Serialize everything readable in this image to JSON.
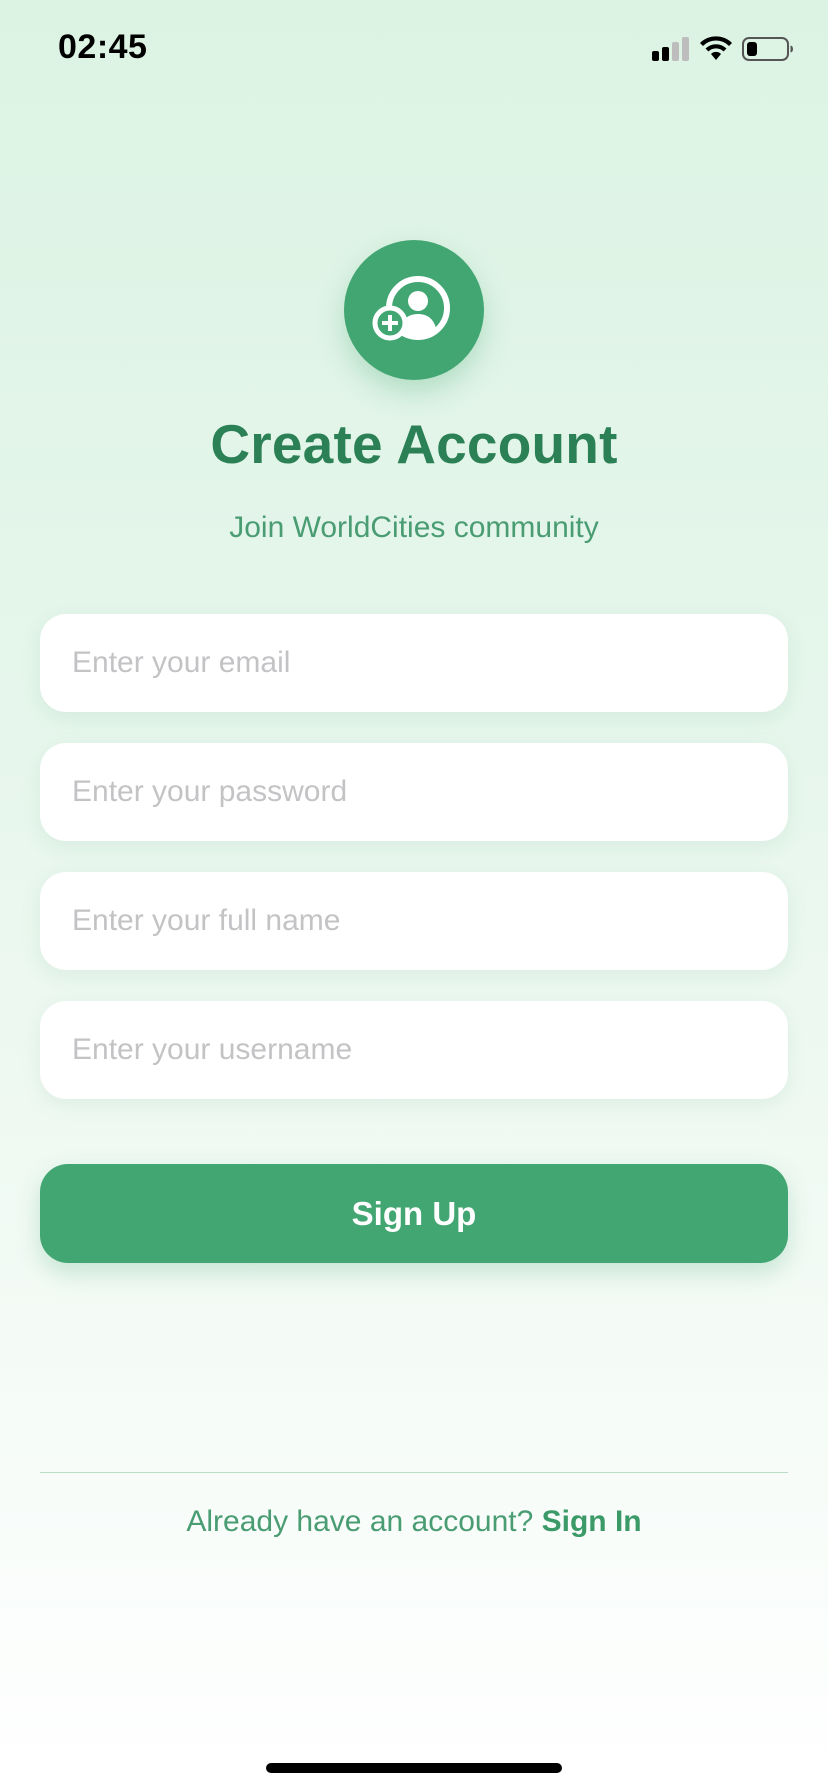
{
  "status_bar": {
    "time": "02:45",
    "icons": [
      "cellular-signal-icon",
      "wifi-icon",
      "battery-icon"
    ]
  },
  "header": {
    "logo_icon": "add-user-icon",
    "title": "Create Account",
    "subtitle": "Join WorldCities community"
  },
  "form": {
    "email_placeholder": "Enter your email",
    "email_value": "",
    "password_placeholder": "Enter your password",
    "password_value": "",
    "fullname_placeholder": "Enter your full name",
    "fullname_value": "",
    "username_placeholder": "Enter your username",
    "username_value": "",
    "submit_label": "Sign Up"
  },
  "footer": {
    "prompt": "Already have an account?",
    "signin_label": "Sign In"
  },
  "colors": {
    "accent": "#42a672",
    "title": "#2c8055",
    "subtitle": "#4a9c73",
    "placeholder": "#c3c3c6"
  }
}
